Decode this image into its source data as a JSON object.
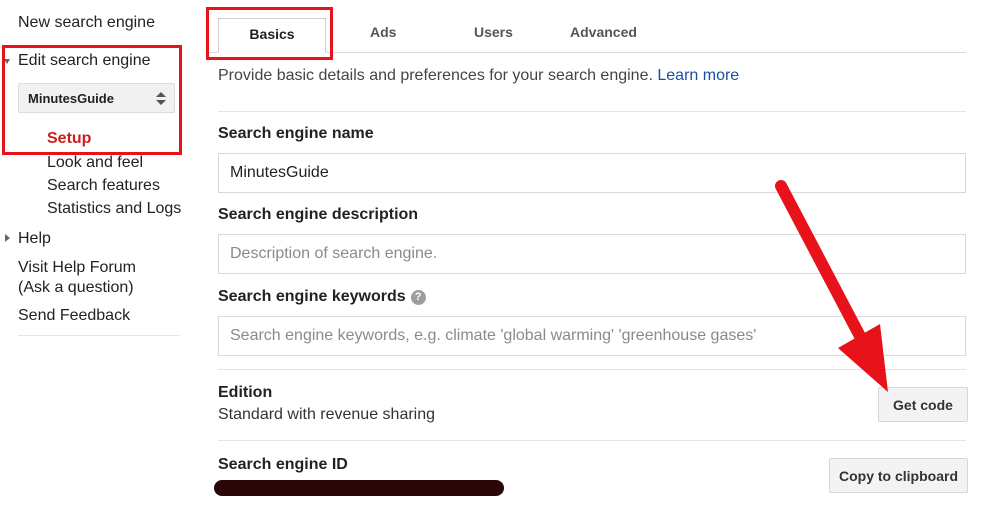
{
  "sidebar": {
    "new_engine": "New search engine",
    "edit_engine": "Edit search engine",
    "engine_select": "MinutesGuide",
    "items": [
      {
        "label": "Setup"
      },
      {
        "label": "Look and feel"
      },
      {
        "label": "Search features"
      },
      {
        "label": "Statistics and Logs"
      }
    ],
    "help": "Help",
    "forum_line1": "Visit Help Forum",
    "forum_line2": "(Ask a question)",
    "feedback": "Send Feedback"
  },
  "tabs": [
    {
      "label": "Basics",
      "active": true
    },
    {
      "label": "Ads"
    },
    {
      "label": "Users"
    },
    {
      "label": "Advanced"
    }
  ],
  "main": {
    "intro": "Provide basic details and preferences for your search engine.",
    "learn_more": "Learn more",
    "name_label": "Search engine name",
    "name_value": "MinutesGuide",
    "description_label": "Search engine description",
    "description_placeholder": "Description of search engine.",
    "keywords_label": "Search engine keywords",
    "keywords_help": "?",
    "keywords_placeholder": "Search engine keywords, e.g. climate 'global warming' 'greenhouse gases'",
    "edition_label": "Edition",
    "edition_value": "Standard with revenue sharing",
    "get_code_button": "Get code",
    "engine_id_label": "Search engine ID",
    "copy_button": "Copy to clipboard"
  },
  "colors": {
    "highlight_red": "#e8121b",
    "link_blue": "#1a4fa0",
    "setup_red": "#c5221f",
    "redaction": "#2a0606"
  },
  "icons": [
    "expand-triangle-icon",
    "collapse-triangle-icon",
    "select-arrows-icon",
    "help-icon"
  ]
}
